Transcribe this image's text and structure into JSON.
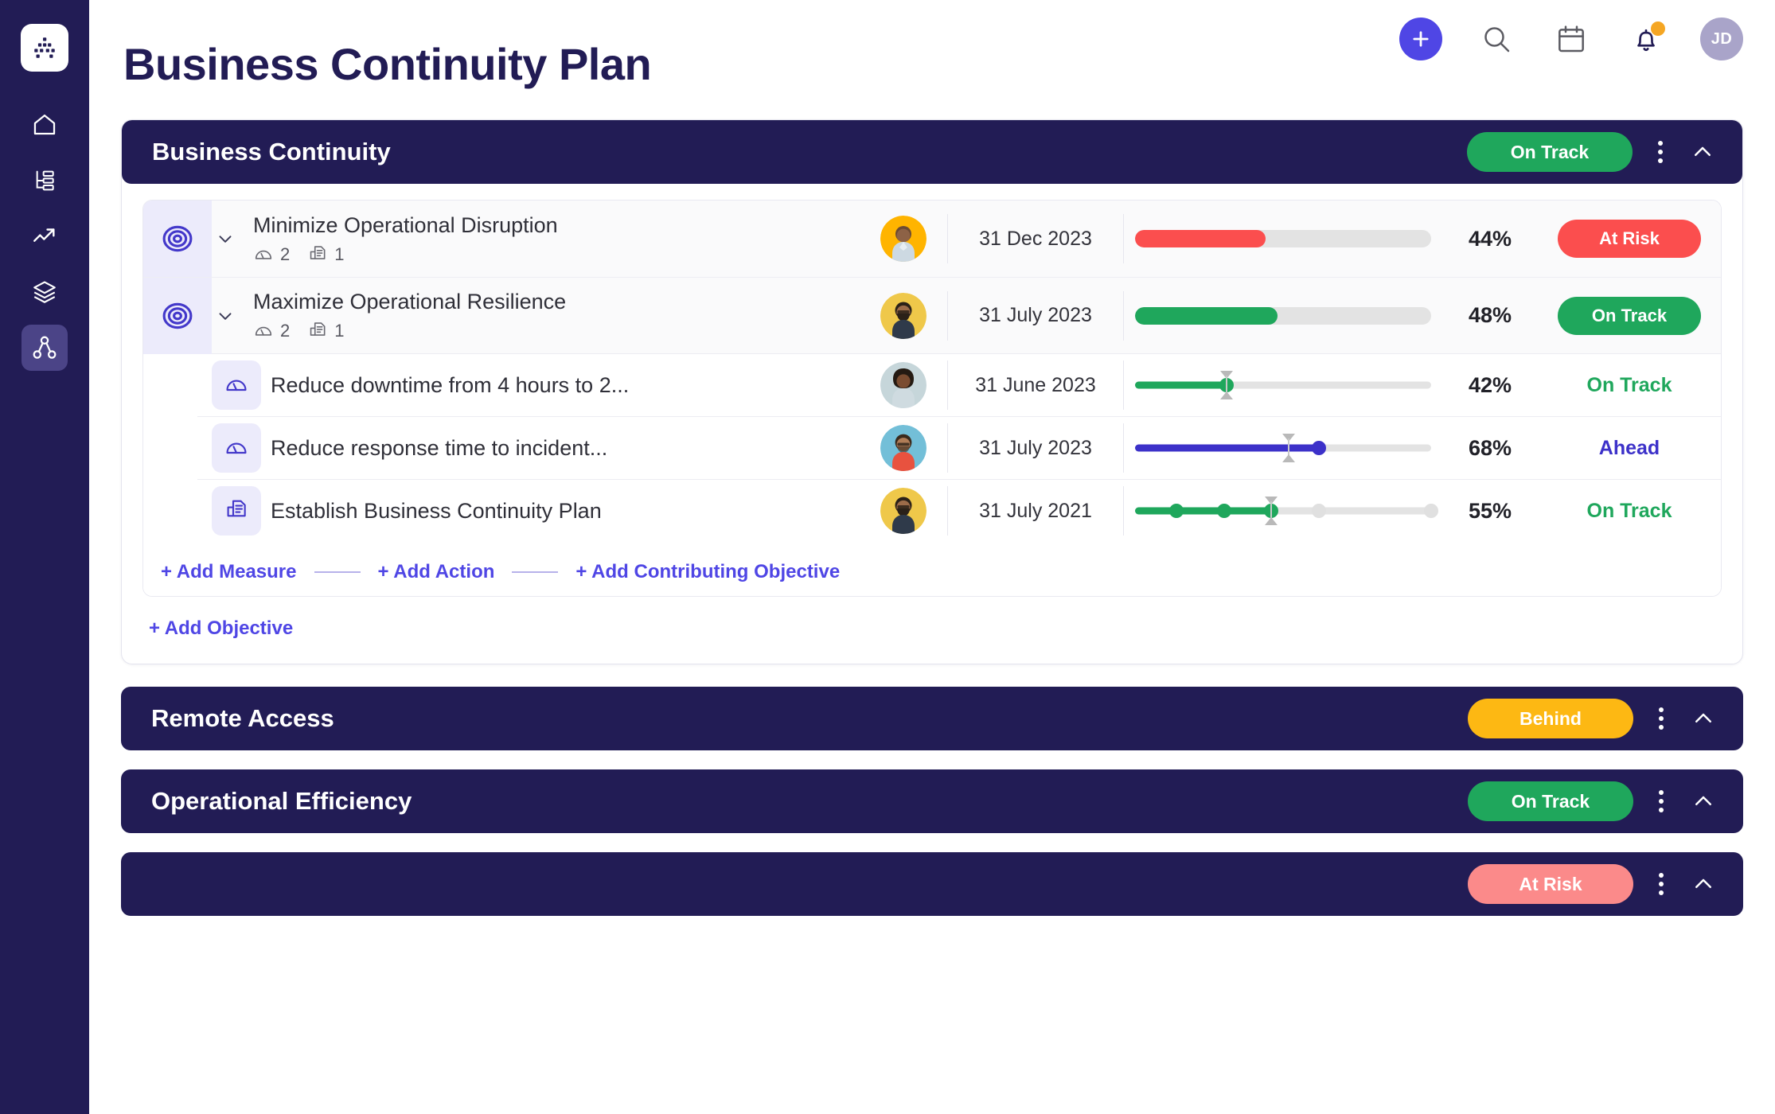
{
  "app": {
    "page_title": "Business Continuity Plan",
    "user_initials": "JD",
    "accent": "#4f46e5",
    "sidebar_bg": "#221C55"
  },
  "topbar": {
    "add_icon": "plus-icon",
    "search_icon": "search-icon",
    "calendar_icon": "calendar-icon",
    "notifications_icon": "bell-icon",
    "avatar_label": "JD"
  },
  "sidebar": {
    "logo": "org-chart-logo",
    "items": [
      {
        "icon": "home-icon",
        "name": "home",
        "active": false
      },
      {
        "icon": "list-tree-icon",
        "name": "plans",
        "active": false
      },
      {
        "icon": "trending-up-icon",
        "name": "analytics",
        "active": false
      },
      {
        "icon": "layers-icon",
        "name": "layers",
        "active": false
      },
      {
        "icon": "network-nodes-icon",
        "name": "strategy-map",
        "active": true
      }
    ]
  },
  "goals": [
    {
      "title": "Business Continuity",
      "status": "On Track",
      "status_color": "#1FA75C",
      "expanded": true
    },
    {
      "title": "Remote Access",
      "status": "Behind",
      "status_color": "#FDB813",
      "expanded": false
    },
    {
      "title": "Operational Efficiency",
      "status": "On Track",
      "status_color": "#1FA75C",
      "expanded": false
    },
    {
      "title": "",
      "status": "At Risk",
      "status_color": "#FB8A8A",
      "expanded": false
    }
  ],
  "objectives": [
    {
      "icon": "target-icon",
      "name": "Minimize Operational Disruption",
      "measures_count": "2",
      "actions_count": "1",
      "owner_avatar": "avatar-man-yellow",
      "due_date": "31 Dec 2023",
      "progress": 44,
      "progress_label": "44%",
      "bar_color": "#FB4E4E",
      "status": "At Risk",
      "status_color": "#FB4E4E",
      "status_style": "pill"
    },
    {
      "icon": "target-icon",
      "name": "Maximize Operational Resilience",
      "measures_count": "2",
      "actions_count": "1",
      "owner_avatar": "avatar-man-beard",
      "due_date": "31 July 2023",
      "progress": 48,
      "progress_label": "48%",
      "bar_color": "#1FA75C",
      "status": "On Track",
      "status_color": "#1FA75C",
      "status_style": "pill"
    }
  ],
  "measures": [
    {
      "icon": "gauge-icon",
      "name": "Reduce downtime from 4 hours to 2...",
      "owner_avatar": "avatar-woman",
      "due_date": "31 June 2023",
      "progress": 31,
      "marker": 31,
      "progress_label": "42%",
      "bar_color": "#1FA75C",
      "status": "On Track",
      "status_color": "#1FA75C",
      "type": "slider"
    },
    {
      "icon": "gauge-icon",
      "name": "Reduce response time to incident...",
      "owner_avatar": "avatar-man-red",
      "due_date": "31 July 2023",
      "progress": 62,
      "marker": 52,
      "progress_label": "68%",
      "bar_color": "#3C31C9",
      "status": "Ahead",
      "status_color": "#3C31C9",
      "type": "slider"
    },
    {
      "icon": "action-doc-icon",
      "name": "Establish Business Continuity Plan",
      "owner_avatar": "avatar-man-yellow2",
      "due_date": "31 July 2021",
      "progress": 46,
      "marker": 46,
      "progress_label": "55%",
      "bar_color": "#1FA75C",
      "status": "On Track",
      "status_color": "#1FA75C",
      "type": "milestones",
      "milestones": [
        {
          "pos": 14,
          "done": true
        },
        {
          "pos": 30,
          "done": true
        },
        {
          "pos": 46,
          "done": true
        },
        {
          "pos": 62,
          "done": false
        },
        {
          "pos": 100,
          "done": false
        }
      ]
    }
  ],
  "add_links": {
    "measure": "+ Add Measure",
    "action": "+ Add Action",
    "contributing_objective": "+ Add Contributing Objective",
    "objective": "+ Add Objective"
  }
}
